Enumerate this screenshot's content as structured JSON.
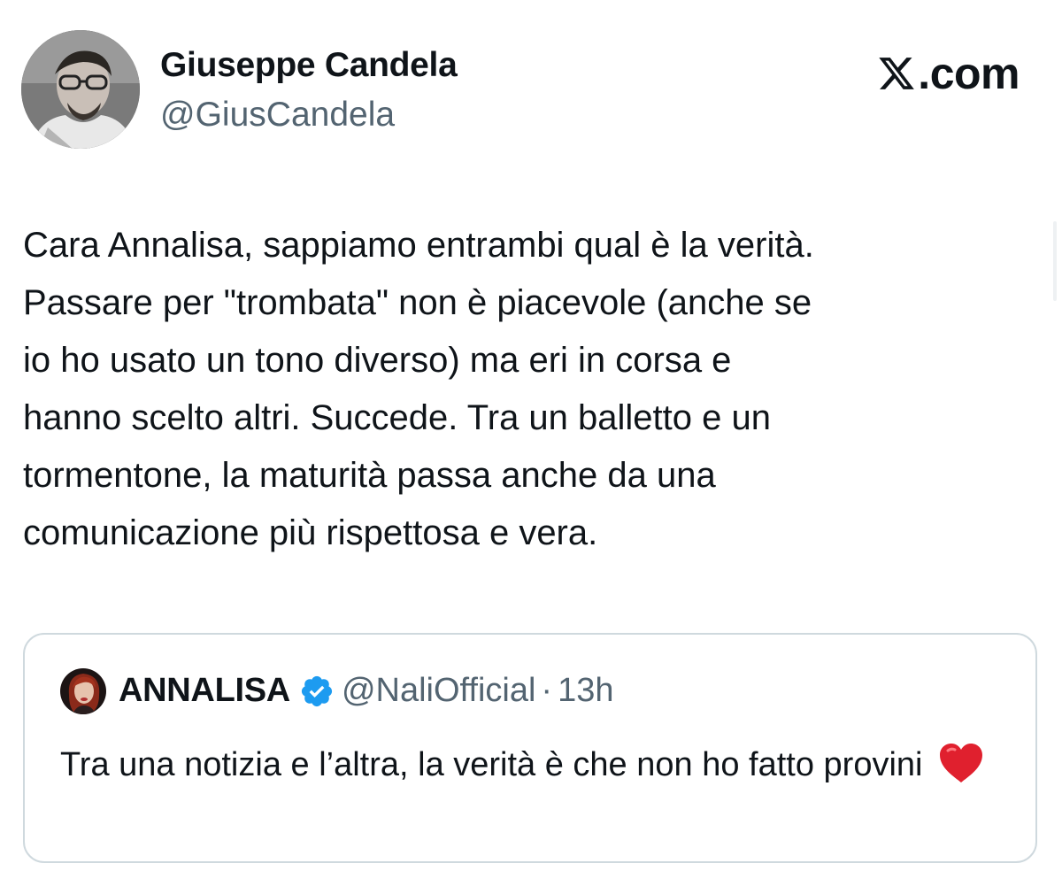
{
  "tweet": {
    "author": {
      "name": "Giuseppe Candela",
      "handle": "@GiusCandela",
      "avatar_icon": "user-photo-avatar"
    },
    "brand": {
      "label": ".com",
      "icon": "x-logo-icon"
    },
    "text": "Cara Annalisa, sappiamo entrambi qual è la verità.\nPassare per \"trombata\" non è piacevole (anche se\nio ho usato un tono diverso) ma eri in corsa e\nhanno scelto altri. Succede. Tra un balletto e un\ntormentone, la maturità passa anche da una\ncomunicazione più rispettosa e vera."
  },
  "quoted_tweet": {
    "author": {
      "name": "ANNALISA",
      "verified_icon": "verified-badge-icon",
      "handle": "@NaliOfficial",
      "separator": "·",
      "time": "13h"
    },
    "text": "Tra una notizia e l’altra, la verità è che non ho fatto provini",
    "emoji": "red-heart-icon"
  },
  "colors": {
    "primary_text": "#0f1419",
    "secondary_text": "#536471",
    "border": "#cfd9de",
    "verified_blue": "#1d9bf0",
    "heart_red": "#e0202e"
  }
}
